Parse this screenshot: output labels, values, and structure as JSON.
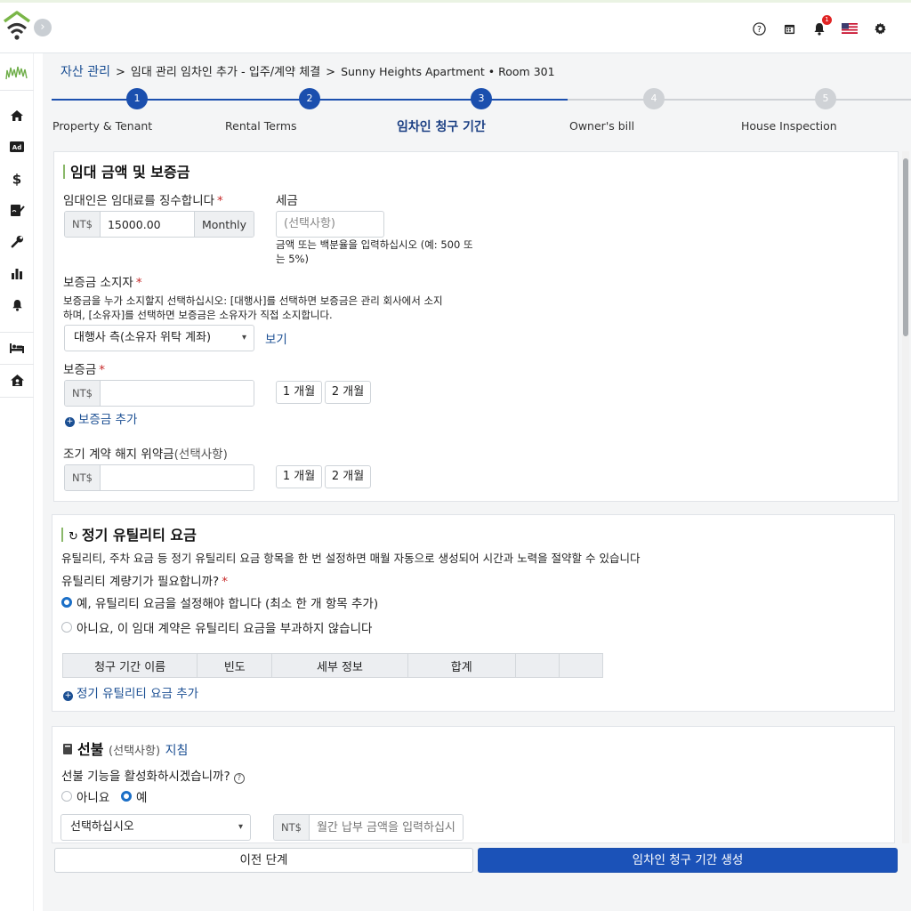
{
  "breadcrumb": {
    "root": "자산 관리",
    "separator": ">",
    "page": "임대 관리 임차인 추가 - 입주/계약 체결",
    "property": "Sunny Heights Apartment • Room 301"
  },
  "stepper": {
    "steps": [
      {
        "num": "1",
        "label": "Property & Tenant",
        "state": "done"
      },
      {
        "num": "2",
        "label": "Rental Terms",
        "state": "done"
      },
      {
        "num": "3",
        "label": "임차인 청구 기간",
        "state": "current"
      },
      {
        "num": "4",
        "label": "Owner's bill",
        "state": "todo"
      },
      {
        "num": "5",
        "label": "House Inspection",
        "state": "todo"
      }
    ]
  },
  "rent_section": {
    "title": "임대 금액 및 보증금",
    "rent_label": "임대인은 임대료를 징수합니다",
    "required_mark": "*",
    "currency": "NT$",
    "rent_value": "15000.00",
    "rent_period": "Monthly",
    "tax_label": "세금",
    "tax_placeholder": "(선택사항)",
    "tax_hint": "금액 또는 백분율을 입력하십시오 (예: 500 또는 5%)",
    "holder_label": "보증금 소지자",
    "holder_desc": "보증금을 누가 소지할지 선택하십시오: [대행사]를 선택하면 보증금은 관리 회사에서 소지하며, [소유자]를 선택하면 보증금은 소유자가 직접 소지합니다.",
    "holder_value": "대행사 측(소유자 위탁 계좌)",
    "view_link": "보기",
    "deposit_label": "보증금",
    "deposit_value": "",
    "one_month": "1 개월",
    "two_month": "2 개월",
    "add_deposit": "보증금 추가",
    "early_label": "조기 계약 해지 위약금",
    "early_optional": "(선택사항)",
    "early_value": ""
  },
  "utility_section": {
    "title": "정기 유틸리티 요금",
    "desc": "유틸리티, 주차 요금 등 정기 유틸리티 요금 항목을 한 번 설정하면 매월 자동으로 생성되어 시간과 노력을 절약할 수 있습니다",
    "meter_question": "유틸리티 계량기가 필요합니까?",
    "required_mark": "*",
    "option_yes": "예, 유틸리티 요금을 설정해야 합니다 (최소 한 개 항목 추가)",
    "option_no": "아니요, 이 임대 계약은 유틸리티 요금을 부과하지 않습니다",
    "selected": "yes",
    "columns": [
      "청구 기간 이름",
      "빈도",
      "세부 정보",
      "합계",
      "",
      ""
    ],
    "add_link": "정기 유틸리티 요금 추가"
  },
  "prepay_section": {
    "title": "선불",
    "optional": "(선택사항)",
    "guide_link": "지침",
    "question": "선불 기능을 활성화하시겠습니까?",
    "option_no": "아니요",
    "option_yes": "예",
    "selected": "yes",
    "select_placeholder": "선택하십시오",
    "currency": "NT$",
    "amount_placeholder": "월간 납부 금액을 입력하십시오"
  },
  "footer": {
    "prev_label": "이전 단계",
    "next_label": "임차인 청구 기간 생성"
  },
  "notifications": {
    "count": "1"
  },
  "colors": {
    "primary": "#1b52b8",
    "link": "#1b4f93",
    "accent_green": "#8ab86a",
    "danger": "#e02424"
  },
  "icons": {
    "sidebar": [
      "home-icon",
      "ad-icon",
      "dollar-icon",
      "signature-icon",
      "wrench-icon",
      "bar-chart-icon",
      "bell-icon",
      "bed-icon",
      "house-user-icon"
    ],
    "top": [
      "help-icon",
      "calendar-icon",
      "bell-icon",
      "us-flag-icon",
      "gear-icon"
    ]
  }
}
